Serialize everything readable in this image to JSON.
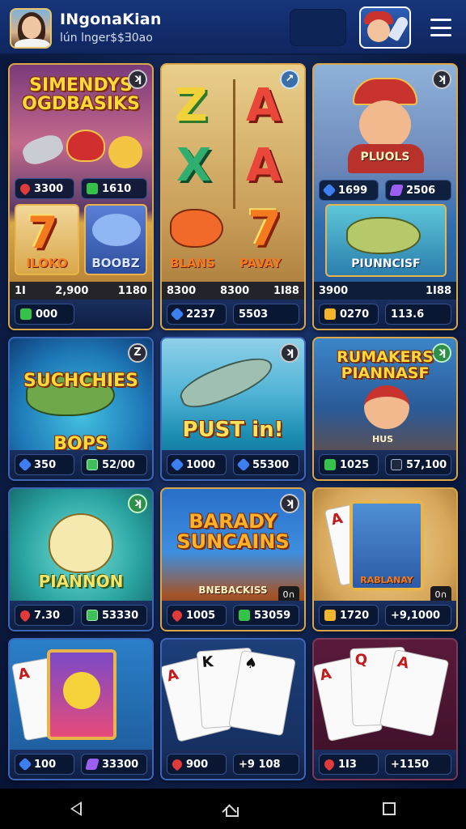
{
  "header": {
    "user_name": "INgonaKian",
    "user_sub": "lún lnger$$Ǝ0аo"
  },
  "cards": [
    {
      "title": "SIMENDYS\nOGDBASIKS",
      "badge": "ʞ",
      "inner_left": "3300",
      "inner_right": "1610",
      "tile_a": "ILOKO",
      "tile_b": "BOOBZ",
      "strip_left": "1I",
      "strip_mid": "2,900",
      "strip_right": "1180",
      "stat_left": "000",
      "stat_right": ""
    },
    {
      "title": "",
      "badge": "↗",
      "letters": [
        "Z",
        "A",
        "X",
        "A"
      ],
      "tile_a": "BLANS",
      "tile_b": "PAVAY",
      "strip_left": "8300",
      "strip_mid": "8300",
      "strip_right": "1I88",
      "stat_left": "2237",
      "stat_right": "5503"
    },
    {
      "title": "PLUOLS",
      "badge": "ʞ",
      "inner_left": "1699",
      "inner_right": "2506",
      "tile_a": "PIUNNCISF",
      "strip_left": "3900",
      "strip_right": "1I88",
      "stat_left": "0270",
      "stat_right": "113.6"
    },
    {
      "title": "SUCHCHIES\nBOPS",
      "badge": "Z",
      "stat_left": "350",
      "stat_right": "52/00"
    },
    {
      "title": "PUST in!",
      "badge": "ʞ",
      "stat_left": "1000",
      "stat_right": "55300"
    },
    {
      "title": "RUMAKERS\nPIANNASF",
      "badge": "ʞ",
      "caption": "HUS",
      "stat_left": "1025",
      "stat_right": "57,100"
    },
    {
      "title": "PIANNON",
      "badge": "ʞ",
      "stat_left": "7.30",
      "stat_right": "53330"
    },
    {
      "title": "BARADY\nSUNCAINS",
      "subtitle": "BNEBACKISS",
      "badge": "ʞ",
      "stat_left": "1005",
      "stat_right": "53059",
      "corner_tag": "0∩"
    },
    {
      "title": "RABLANAY",
      "badge": "",
      "stat_left": "1720",
      "stat_right": "+9,1000",
      "corner_tag": "0∩"
    },
    {
      "title": "",
      "stat_left": "100",
      "stat_right": "33300"
    },
    {
      "title": "",
      "stat_left": "900",
      "stat_right": "+9 108"
    },
    {
      "title": "",
      "stat_left": "1I3",
      "stat_right": "+1150"
    }
  ],
  "colors": {
    "accent_gold": "#d9a74a",
    "header_blue": "#16357a",
    "background": "#0d1e47"
  },
  "icons": [
    "hamburger-menu-icon",
    "mascot-icon",
    "back-icon",
    "home-icon",
    "recent-apps-icon"
  ]
}
